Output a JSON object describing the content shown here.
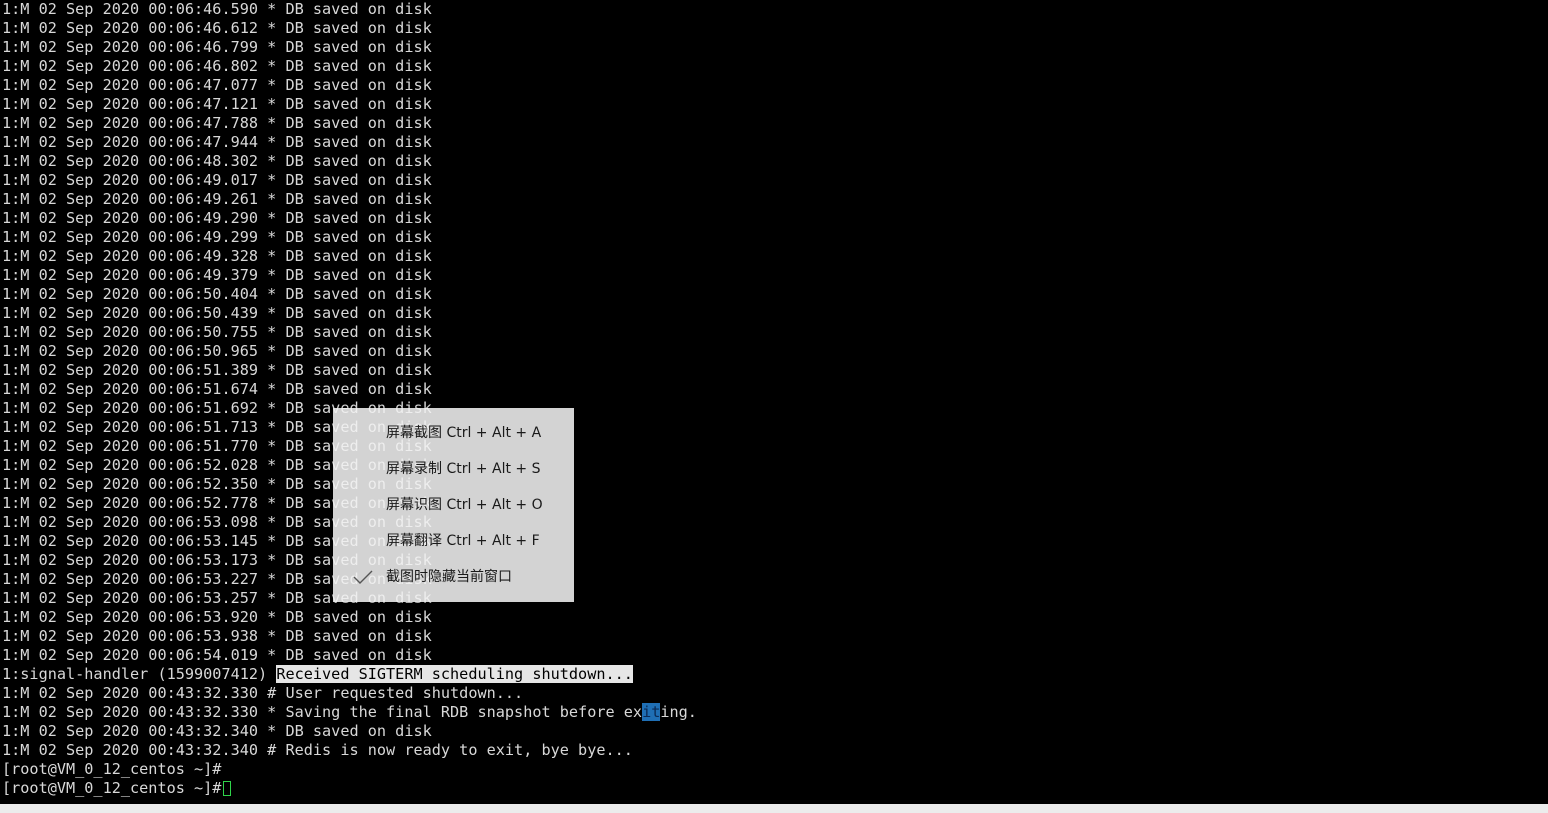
{
  "terminal": {
    "saved_lines": [
      "1:M 02 Sep 2020 00:06:46.590 * DB saved on disk",
      "1:M 02 Sep 2020 00:06:46.612 * DB saved on disk",
      "1:M 02 Sep 2020 00:06:46.799 * DB saved on disk",
      "1:M 02 Sep 2020 00:06:46.802 * DB saved on disk",
      "1:M 02 Sep 2020 00:06:47.077 * DB saved on disk",
      "1:M 02 Sep 2020 00:06:47.121 * DB saved on disk",
      "1:M 02 Sep 2020 00:06:47.788 * DB saved on disk",
      "1:M 02 Sep 2020 00:06:47.944 * DB saved on disk",
      "1:M 02 Sep 2020 00:06:48.302 * DB saved on disk",
      "1:M 02 Sep 2020 00:06:49.017 * DB saved on disk",
      "1:M 02 Sep 2020 00:06:49.261 * DB saved on disk",
      "1:M 02 Sep 2020 00:06:49.290 * DB saved on disk",
      "1:M 02 Sep 2020 00:06:49.299 * DB saved on disk",
      "1:M 02 Sep 2020 00:06:49.328 * DB saved on disk",
      "1:M 02 Sep 2020 00:06:49.379 * DB saved on disk",
      "1:M 02 Sep 2020 00:06:50.404 * DB saved on disk",
      "1:M 02 Sep 2020 00:06:50.439 * DB saved on disk",
      "1:M 02 Sep 2020 00:06:50.755 * DB saved on disk",
      "1:M 02 Sep 2020 00:06:50.965 * DB saved on disk",
      "1:M 02 Sep 2020 00:06:51.389 * DB saved on disk",
      "1:M 02 Sep 2020 00:06:51.674 * DB saved on disk",
      "1:M 02 Sep 2020 00:06:51.692 * DB saved on disk",
      "1:M 02 Sep 2020 00:06:51.713 * DB saved on disk",
      "1:M 02 Sep 2020 00:06:51.770 * DB saved on disk",
      "1:M 02 Sep 2020 00:06:52.028 * DB saved on disk",
      "1:M 02 Sep 2020 00:06:52.350 * DB saved on disk",
      "1:M 02 Sep 2020 00:06:52.778 * DB saved on disk",
      "1:M 02 Sep 2020 00:06:53.098 * DB saved on disk",
      "1:M 02 Sep 2020 00:06:53.145 * DB saved on disk",
      "1:M 02 Sep 2020 00:06:53.173 * DB saved on disk",
      "1:M 02 Sep 2020 00:06:53.227 * DB saved on disk",
      "1:M 02 Sep 2020 00:06:53.257 * DB saved on disk",
      "1:M 02 Sep 2020 00:06:53.920 * DB saved on disk",
      "1:M 02 Sep 2020 00:06:53.938 * DB saved on disk",
      "1:M 02 Sep 2020 00:06:54.019 * DB saved on disk"
    ],
    "signal_line": {
      "prefix": "1:signal-handler (1599007412) ",
      "highlighted": "Received SIGTERM scheduling shutdown..."
    },
    "shutdown_line": "1:M 02 Sep 2020 00:43:32.330 # User requested shutdown...",
    "snapshot_line": {
      "before": "1:M 02 Sep 2020 00:43:32.330 * Saving the final RDB snapshot before ex",
      "selected": "it",
      "after": "ing."
    },
    "final_saved_line": "1:M 02 Sep 2020 00:43:32.340 * DB saved on disk",
    "exit_line": "1:M 02 Sep 2020 00:43:32.340 # Redis is now ready to exit, bye bye...",
    "prompt_1": "[root@VM_0_12_centos ~]#",
    "prompt_2": "[root@VM_0_12_centos ~]#",
    "colors": {
      "background": "#000000",
      "text": "#d8d8d8",
      "highlight_bg": "#e6e6e6",
      "selection_bg": "#1f6fb5",
      "cursor": "#2fd44a"
    }
  },
  "context_menu": {
    "items": [
      {
        "label": "屏幕截图 Ctrl + Alt + A",
        "checked": false
      },
      {
        "label": "屏幕录制 Ctrl + Alt + S",
        "checked": false
      },
      {
        "label": "屏幕识图 Ctrl + Alt + O",
        "checked": false
      },
      {
        "label": "屏幕翻译 Ctrl + Alt + F",
        "checked": false
      },
      {
        "label": "截图时隐藏当前窗口",
        "checked": true,
        "icon": "checkmark-icon"
      }
    ]
  }
}
